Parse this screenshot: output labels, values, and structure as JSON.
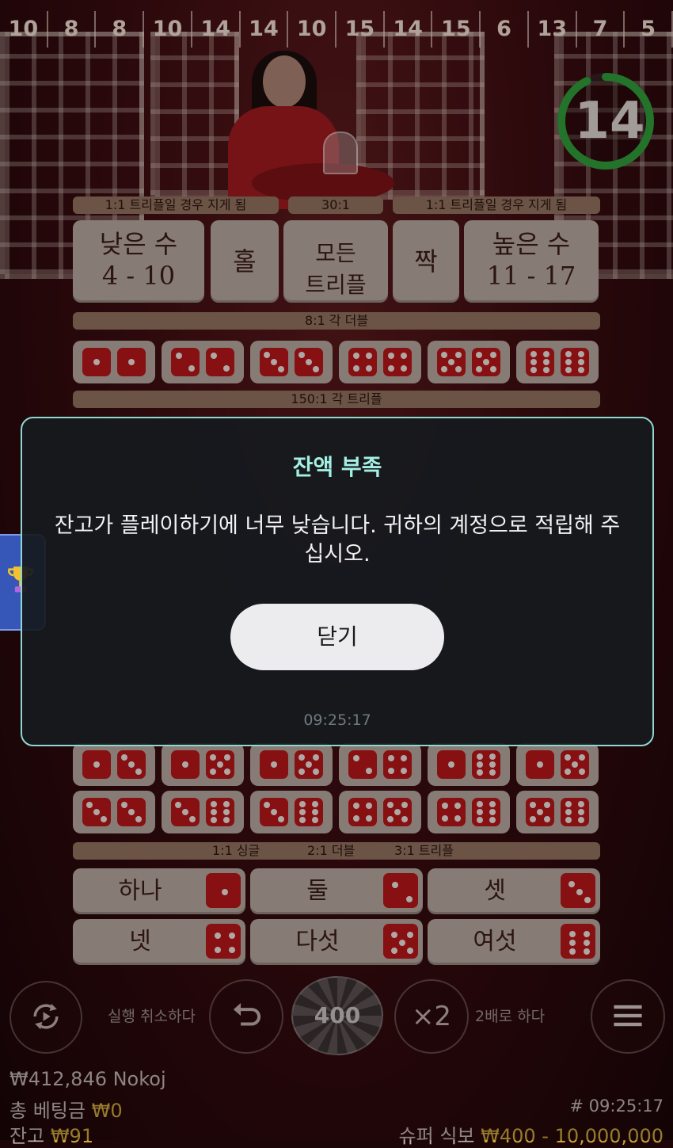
{
  "history": [
    "10",
    "8",
    "8",
    "10",
    "14",
    "14",
    "10",
    "15",
    "14",
    "15",
    "6",
    "13",
    "7",
    "5"
  ],
  "timer": {
    "value": "14",
    "fraction_remaining": 0.93
  },
  "board": {
    "top_bands": {
      "left": "1:1 트리플일 경우 지게 됨",
      "center": "30:1",
      "right": "1:1 트리플일 경우 지게 됨"
    },
    "low": {
      "label": "낮은 수",
      "range": "4 - 10"
    },
    "odd": {
      "label": "홀"
    },
    "any_triple": {
      "line1": "모든",
      "line2": "트리플"
    },
    "even": {
      "label": "짝"
    },
    "high": {
      "label": "높은 수",
      "range": "11 - 17"
    },
    "doubles_band": "8:1 각 더블",
    "doubles": [
      1,
      2,
      3,
      4,
      5,
      6
    ],
    "triples_band": "150:1 각 트리플",
    "combos_row1": [
      [
        1,
        3
      ],
      [
        1,
        5
      ],
      [
        1,
        5
      ],
      [
        2,
        4
      ],
      [
        1,
        6
      ],
      [
        1,
        5
      ]
    ],
    "combos_row2": [
      [
        3,
        3
      ],
      [
        3,
        6
      ],
      [
        3,
        6
      ],
      [
        4,
        5
      ],
      [
        4,
        6
      ],
      [
        5,
        6
      ]
    ],
    "singles_band": {
      "a": "1:1 싱글",
      "b": "2:1 더블",
      "c": "3:1 트리플"
    },
    "singles": [
      {
        "label": "하나",
        "die": 1
      },
      {
        "label": "둘",
        "die": 2
      },
      {
        "label": "셋",
        "die": 3
      },
      {
        "label": "넷",
        "die": 4
      },
      {
        "label": "다섯",
        "die": 5
      },
      {
        "label": "여섯",
        "die": 6
      }
    ]
  },
  "controls": {
    "undo_label": "실행 취소하다",
    "chip_value": "400",
    "double_symbol": "×2",
    "double_label": "2배로 하다"
  },
  "footer": {
    "nickname": "₩412,846 Nokoj",
    "total_bet_label": "총 베팅금",
    "total_bet_value": "₩0",
    "balance_label": "잔고",
    "balance_value": "₩91",
    "round_id": "# 09:25:17",
    "limits_label": "슈퍼 식보",
    "limits_value": "₩400 - 10,000,000"
  },
  "modal": {
    "title": "잔액 부족",
    "message": "잔고가 플레이하기에 너무 낮습니다. 귀하의 계정으로 적립해 주십시오.",
    "close_label": "닫기",
    "time": "09:25:17"
  },
  "colors": {
    "accent": "#a4efe4",
    "modal_border": "#8fd8d0",
    "die": "#b4161a",
    "gold": "#c9a53a",
    "timer_ring": "#2f9a3a"
  }
}
